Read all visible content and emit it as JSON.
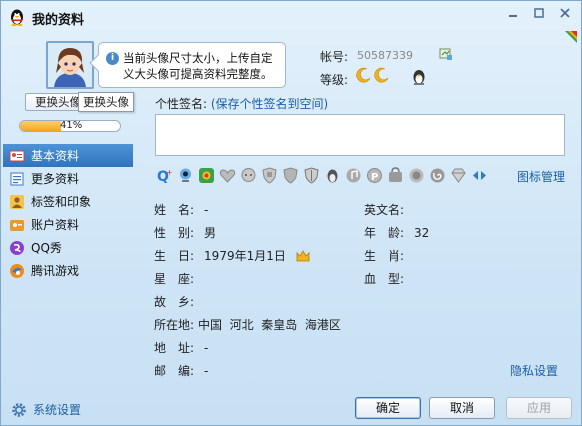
{
  "window": {
    "title": "我的资料",
    "controls": [
      "minimize",
      "maximize",
      "close"
    ]
  },
  "avatar": {
    "tooltip": "当前头像尺寸太小，上传自定义大头像可提高资料完整度。",
    "change_button_label": "更换头像",
    "hover_tooltip": "更换头像",
    "completeness_percent": 41,
    "completeness_text": "41%"
  },
  "account": {
    "account_label": "帐号:",
    "account_number": "50587339",
    "level_label": "等级:",
    "level_icons": [
      "moon-icon",
      "moon-icon"
    ]
  },
  "sidebar": {
    "items": [
      {
        "label": "基本资料",
        "icon": "contact-card-icon",
        "active": true
      },
      {
        "label": "更多资料",
        "icon": "document-list-icon",
        "active": false
      },
      {
        "label": "标签和印象",
        "icon": "person-tag-icon",
        "active": false
      },
      {
        "label": "账户资料",
        "icon": "account-icon",
        "active": false
      },
      {
        "label": "QQ秀",
        "icon": "qqshow-icon",
        "active": false
      },
      {
        "label": "腾讯游戏",
        "icon": "game-icon",
        "active": false
      }
    ],
    "settings_label": "系统设置"
  },
  "signature": {
    "label": "个性签名:",
    "link": "(保存个性签名到空间)",
    "value": ""
  },
  "icon_row": {
    "manage_label": "图标管理"
  },
  "profile": {
    "name_label": "姓　名:",
    "name_value": "-",
    "english_label": "英文名:",
    "english_value": "",
    "gender_label": "性　别:",
    "gender_value": "男",
    "age_label": "年　龄:",
    "age_value": "32",
    "birthday_label": "生　日:",
    "birthday_value": "1979年1月1日",
    "zodiac_label": "生　肖:",
    "zodiac_value": "",
    "constellation_label": "星　座:",
    "constellation_value": "",
    "blood_label": "血　型:",
    "blood_value": "",
    "hometown_label": "故　乡:",
    "hometown_value": "",
    "location_label": "所在地:",
    "location_value": "中国  河北  秦皇岛  海港区",
    "address_label": "地　址:",
    "address_value": "-",
    "postal_label": "邮　编:",
    "postal_value": "-"
  },
  "privacy_label": "隐私设置",
  "buttons": {
    "ok": "确定",
    "cancel": "取消",
    "apply": "应用"
  }
}
